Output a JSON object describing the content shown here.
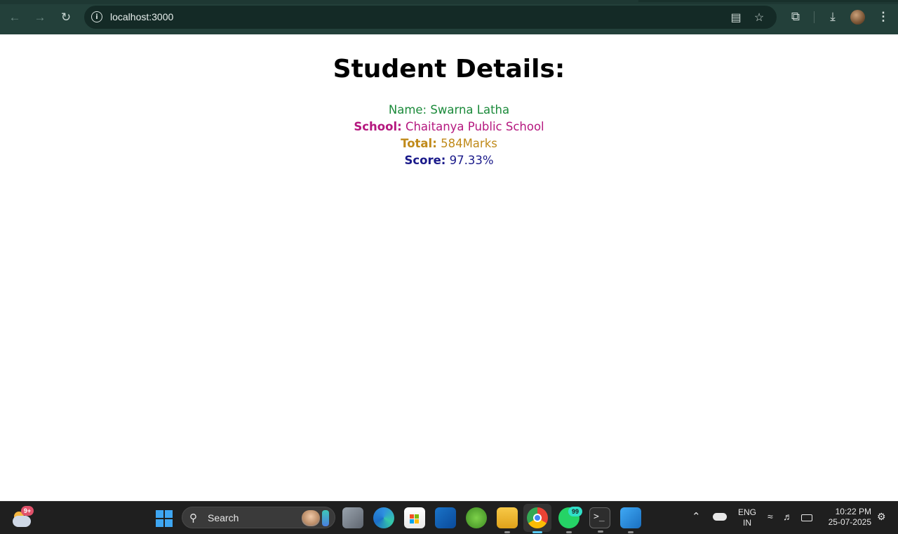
{
  "browser": {
    "url": "localhost:3000",
    "icons": [
      "back-arrow-icon",
      "forward-arrow-icon",
      "reload-icon",
      "site-info-icon",
      "install-app-icon",
      "bookmark-star-icon",
      "extensions-icon",
      "downloads-icon",
      "profile-avatar",
      "menu-kebab-icon"
    ]
  },
  "page": {
    "title": "Student Details:",
    "fields": {
      "name": {
        "label": "Name:",
        "value": "Swarna Latha",
        "color": "#1b8a3a"
      },
      "school": {
        "label": "School:",
        "value": "Chaitanya Public School",
        "color": "#b5187f"
      },
      "total": {
        "label": "Total:",
        "value": "584Marks",
        "color": "#c08a1a"
      },
      "score": {
        "label": "Score:",
        "value": "97.33%",
        "color": "#1a1a8a"
      }
    }
  },
  "taskbar": {
    "weather_badge": "9+",
    "search_label": "Search",
    "whatsapp_badge": "99",
    "apps": [
      "start-windows-icon",
      "task-view-icon",
      "edge-icon",
      "microsoft-store-icon",
      "outlook-icon",
      "spring-tool-icon",
      "file-explorer-icon",
      "chrome-icon",
      "whatsapp-icon",
      "terminal-icon",
      "vscode-icon"
    ],
    "language_line1": "ENG",
    "language_line2": "IN",
    "time": "10:22 PM",
    "date": "25-07-2025"
  }
}
